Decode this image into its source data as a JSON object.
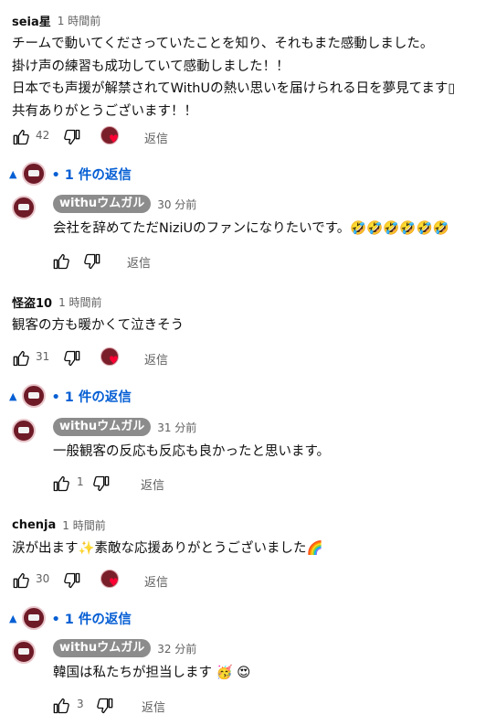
{
  "comments": [
    {
      "author": "seia星",
      "time": "1 時間前",
      "body": "チームで動いてくださっていたことを知り、それもまた感動しました。\n掛け声の練習も成功していて感動しました！！\n日本でも声援が解禁されてWithUの熱い思いを届けられる日を夢見てます▯\n共有ありがとうございます！！",
      "likes": "42",
      "reply_label": "返信",
      "replies_toggle": "• 1 件の返信",
      "reply": {
        "author": "withuウムガル",
        "time": "30 分前",
        "body": "会社を辞めてただNiziUのファンになりたいです。🤣🤣🤣🤣🤣🤣",
        "likes": "",
        "reply_label": "返信"
      }
    },
    {
      "author": "怪盗10",
      "time": "1 時間前",
      "body": "観客の方も暖かくて泣きそう",
      "likes": "31",
      "reply_label": "返信",
      "replies_toggle": "• 1 件の返信",
      "reply": {
        "author": "withuウムガル",
        "time": "31 分前",
        "body": "一般観客の反応も反応も良かったと思います。",
        "likes": "1",
        "reply_label": "返信"
      }
    },
    {
      "author": "chenja",
      "time": "1 時間前",
      "body": "涙が出ます✨素敵な応援ありがとうございました🌈",
      "likes": "30",
      "reply_label": "返信",
      "replies_toggle": "• 1 件の返信",
      "reply": {
        "author": "withuウムガル",
        "time": "32 分前",
        "body": "韓国は私たちが担当します 🥳 😍",
        "likes": "3",
        "reply_label": "返信"
      }
    }
  ],
  "colors": {
    "link": "#065fd4",
    "muted": "#606060",
    "heart": "#ff0033"
  },
  "icons": [
    "thumb-up-icon",
    "thumb-down-icon",
    "heart-icon",
    "caret-up-icon"
  ]
}
